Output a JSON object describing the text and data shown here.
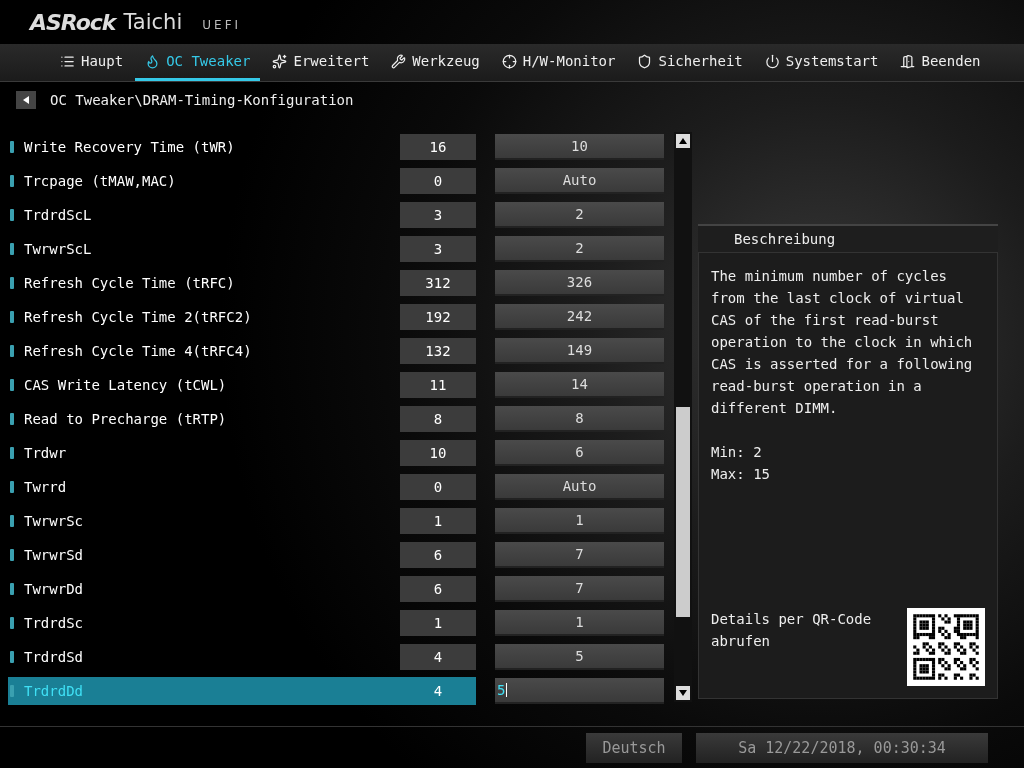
{
  "brand": {
    "logo": "ASRock",
    "product": "Taichi",
    "mode": "UEFI"
  },
  "tabs": [
    {
      "label": "Haupt",
      "selected": false
    },
    {
      "label": "OC Tweaker",
      "selected": true
    },
    {
      "label": "Erweitert",
      "selected": false
    },
    {
      "label": "Werkzeug",
      "selected": false
    },
    {
      "label": "H/W-Monitor",
      "selected": false
    },
    {
      "label": "Sicherheit",
      "selected": false
    },
    {
      "label": "Systemstart",
      "selected": false
    },
    {
      "label": "Beenden",
      "selected": false
    }
  ],
  "breadcrumb": "OC Tweaker\\DRAM-Timing-Konfiguration",
  "settings": [
    {
      "name": "Write Recovery Time (tWR)",
      "current": "16",
      "value": "10",
      "selected": false
    },
    {
      "name": "Trcpage (tMAW,MAC)",
      "current": "0",
      "value": "Auto",
      "selected": false
    },
    {
      "name": "TrdrdScL",
      "current": "3",
      "value": "2",
      "selected": false
    },
    {
      "name": "TwrwrScL",
      "current": "3",
      "value": "2",
      "selected": false
    },
    {
      "name": "Refresh Cycle Time  (tRFC)",
      "current": "312",
      "value": "326",
      "selected": false
    },
    {
      "name": "Refresh Cycle Time 2(tRFC2)",
      "current": "192",
      "value": "242",
      "selected": false
    },
    {
      "name": "Refresh Cycle Time 4(tRFC4)",
      "current": "132",
      "value": "149",
      "selected": false
    },
    {
      "name": "CAS Write Latency (tCWL)",
      "current": "11",
      "value": "14",
      "selected": false
    },
    {
      "name": "Read to Precharge (tRTP)",
      "current": "8",
      "value": "8",
      "selected": false
    },
    {
      "name": "Trdwr",
      "current": "10",
      "value": "6",
      "selected": false
    },
    {
      "name": "Twrrd",
      "current": "0",
      "value": "Auto",
      "selected": false
    },
    {
      "name": "TwrwrSc",
      "current": "1",
      "value": "1",
      "selected": false
    },
    {
      "name": "TwrwrSd",
      "current": "6",
      "value": "7",
      "selected": false
    },
    {
      "name": "TwrwrDd",
      "current": "6",
      "value": "7",
      "selected": false
    },
    {
      "name": "TrdrdSc",
      "current": "1",
      "value": "1",
      "selected": false
    },
    {
      "name": "TrdrdSd",
      "current": "4",
      "value": "5",
      "selected": false
    },
    {
      "name": "TrdrdDd",
      "current": "4",
      "value": "5",
      "selected": true
    }
  ],
  "description": {
    "title": "Beschreibung",
    "text": "The minimum number of cycles from the last clock of virtual CAS of the first read-burst operation to the clock in which CAS is asserted for a following read-burst operation in a different DIMM.",
    "min": "Min: 2",
    "max": "Max: 15",
    "qr_label": "Details per QR-Code abrufen"
  },
  "status_bar": {
    "language": "Deutsch",
    "datetime": "Sa 12/22/2018, 00:30:34"
  }
}
